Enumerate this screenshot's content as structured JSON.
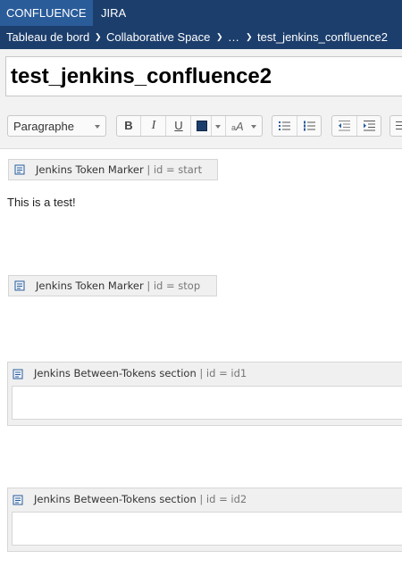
{
  "app_switcher": {
    "confluence": "CONFLUENCE",
    "jira": "JIRA"
  },
  "breadcrumb": {
    "items": [
      "Tableau de bord",
      "Collaborative Space",
      "…",
      "test_jenkins_confluence2"
    ]
  },
  "page": {
    "title": "test_jenkins_confluence2"
  },
  "toolbar": {
    "paragraph_style": "Paragraphe",
    "bold": "B",
    "italic": "I",
    "underline": "U",
    "text_color": "#1c3e6c",
    "font_size_glyph": "A",
    "font_size_small_glyph": "a",
    "icons": [
      "bold-icon",
      "italic-icon",
      "underline-icon",
      "text-color-icon",
      "font-format-icon",
      "bullet-list-icon",
      "numbered-list-icon",
      "outdent-icon",
      "indent-icon"
    ]
  },
  "content": {
    "marker_start": {
      "name": "Jenkins Token Marker",
      "param": " | id = start"
    },
    "body_text": "This is a test!",
    "marker_stop": {
      "name": "Jenkins Token Marker",
      "param": " | id = stop"
    },
    "section_1": {
      "name": "Jenkins Between-Tokens section",
      "param": " | id = id1"
    },
    "section_2": {
      "name": "Jenkins Between-Tokens section",
      "param": " | id = id2"
    }
  },
  "colors": {
    "nav_bg": "#1c3e6c",
    "active_tab_bg": "#2a5c9a",
    "macro_bg": "#f0f0f0"
  }
}
